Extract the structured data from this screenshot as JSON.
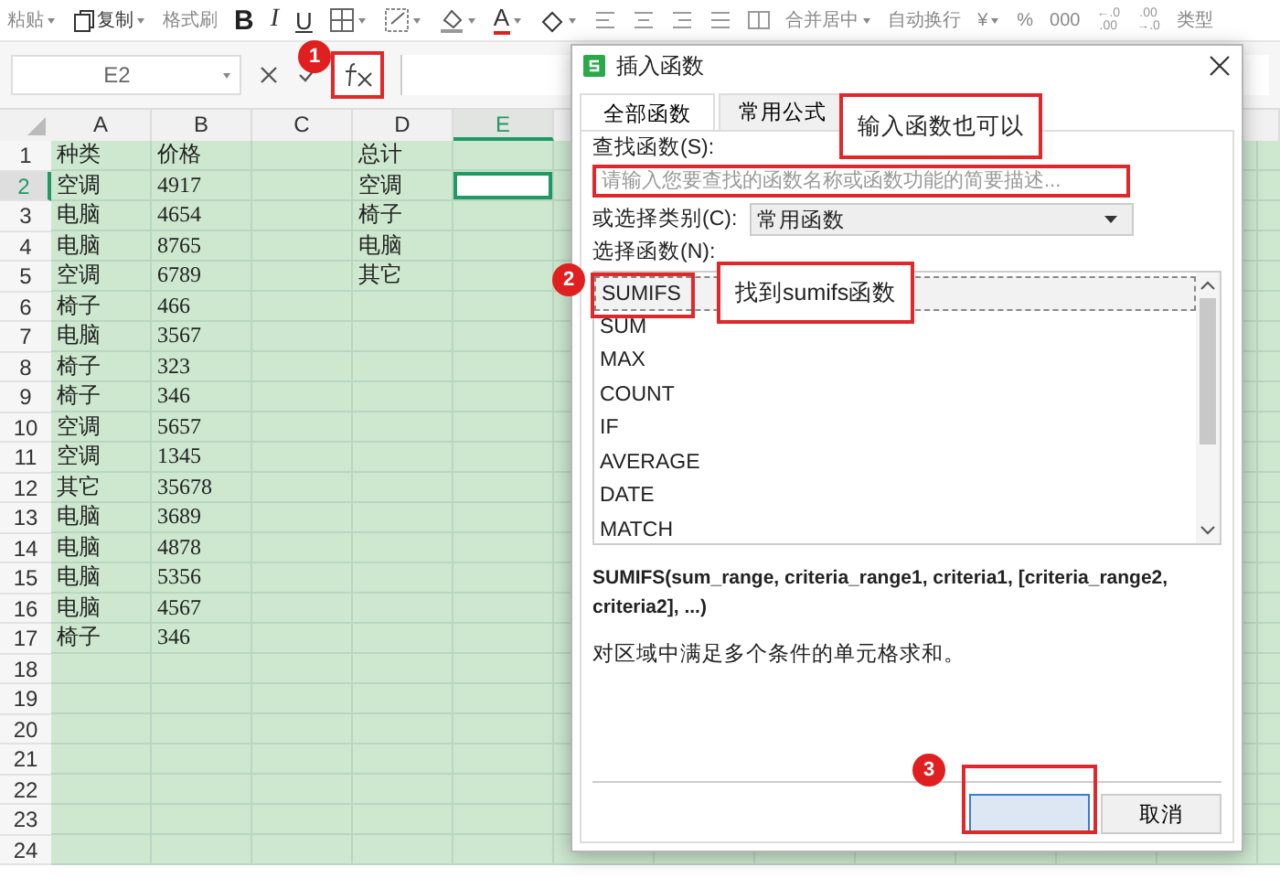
{
  "toolbar": {
    "items": [
      {
        "kind": "text",
        "label": "粘贴",
        "caret": true
      },
      {
        "kind": "copy",
        "label": "复制",
        "caret": true
      },
      {
        "kind": "text",
        "label": "格式刷",
        "caret": false
      },
      {
        "kind": "bold",
        "label": "B",
        "caret": false
      },
      {
        "kind": "italic",
        "label": "I",
        "caret": false
      },
      {
        "kind": "underline",
        "label": "U",
        "caret": false
      },
      {
        "kind": "border",
        "caret": true
      },
      {
        "kind": "cellstyle",
        "caret": true
      },
      {
        "kind": "fill",
        "caret": true
      },
      {
        "kind": "fontcolor",
        "label": "A",
        "caret": true
      },
      {
        "kind": "eraser",
        "caret": true
      },
      {
        "kind": "align_left",
        "caret": false
      },
      {
        "kind": "align_center",
        "caret": false
      },
      {
        "kind": "align_right",
        "caret": false
      },
      {
        "kind": "justify",
        "caret": false
      },
      {
        "kind": "split_cell",
        "caret": false
      },
      {
        "kind": "text",
        "label": "合并居中",
        "caret": true
      },
      {
        "kind": "text",
        "label": "自动换行",
        "caret": false
      },
      {
        "kind": "text",
        "label": "¥",
        "caret": true
      },
      {
        "kind": "text",
        "label": "%",
        "caret": false
      },
      {
        "kind": "text",
        "label": "000",
        "caret": false
      },
      {
        "kind": "stack",
        "top": "←.0",
        "bottom": ".00",
        "caret": false
      },
      {
        "kind": "stack",
        "top": ".00",
        "bottom": "→.0",
        "caret": false
      },
      {
        "kind": "text",
        "label": "类型",
        "caret": false
      }
    ]
  },
  "formula_bar": {
    "cell_ref": "E2"
  },
  "sheet": {
    "columns": [
      {
        "label": "A",
        "selected": false
      },
      {
        "label": "B",
        "selected": false
      },
      {
        "label": "C",
        "selected": false
      },
      {
        "label": "D",
        "selected": false
      },
      {
        "label": "E",
        "selected": true
      }
    ],
    "rows": [
      {
        "number": "1",
        "selected": false,
        "a": "种类",
        "b": "价格",
        "d": "总计"
      },
      {
        "number": "2",
        "selected": true,
        "a": "空调",
        "b": "4917",
        "d": "空调"
      },
      {
        "number": "3",
        "selected": false,
        "a": "电脑",
        "b": "4654",
        "d": "椅子"
      },
      {
        "number": "4",
        "selected": false,
        "a": "电脑",
        "b": "8765",
        "d": "电脑"
      },
      {
        "number": "5",
        "selected": false,
        "a": "空调",
        "b": "6789",
        "d": "其它"
      },
      {
        "number": "6",
        "selected": false,
        "a": "椅子",
        "b": "466"
      },
      {
        "number": "7",
        "selected": false,
        "a": "电脑",
        "b": "3567"
      },
      {
        "number": "8",
        "selected": false,
        "a": "椅子",
        "b": "323"
      },
      {
        "number": "9",
        "selected": false,
        "a": "椅子",
        "b": "346"
      },
      {
        "number": "10",
        "selected": false,
        "a": "空调",
        "b": "5657"
      },
      {
        "number": "11",
        "selected": false,
        "a": "空调",
        "b": "1345"
      },
      {
        "number": "12",
        "selected": false,
        "a": "其它",
        "b": "35678"
      },
      {
        "number": "13",
        "selected": false,
        "a": "电脑",
        "b": "3689"
      },
      {
        "number": "14",
        "selected": false,
        "a": "电脑",
        "b": "4878"
      },
      {
        "number": "15",
        "selected": false,
        "a": "电脑",
        "b": "5356"
      },
      {
        "number": "16",
        "selected": false,
        "a": "电脑",
        "b": "4567"
      },
      {
        "number": "17",
        "selected": false,
        "a": "椅子",
        "b": "346"
      },
      {
        "number": "18",
        "selected": false
      },
      {
        "number": "19",
        "selected": false
      },
      {
        "number": "20",
        "selected": false
      },
      {
        "number": "21",
        "selected": false
      },
      {
        "number": "22",
        "selected": false
      },
      {
        "number": "23",
        "selected": false
      },
      {
        "number": "24",
        "selected": false
      }
    ]
  },
  "dialog": {
    "title": "插入函数",
    "tabs": [
      {
        "label": "全部函数",
        "selected": true
      },
      {
        "label": "常用公式",
        "selected": false
      }
    ],
    "search_label": "查找函数(S):",
    "search_placeholder": "请输入您要查找的函数名称或函数功能的简要描述...",
    "category_label": "或选择类别(C):",
    "category_value": "常用函数",
    "list_label": "选择函数(N):",
    "functions": [
      {
        "name": "SUMIFS",
        "selected": true
      },
      {
        "name": "SUM",
        "selected": false
      },
      {
        "name": "MAX",
        "selected": false
      },
      {
        "name": "COUNT",
        "selected": false
      },
      {
        "name": "IF",
        "selected": false
      },
      {
        "name": "AVERAGE",
        "selected": false
      },
      {
        "name": "DATE",
        "selected": false
      },
      {
        "name": "MATCH",
        "selected": false
      }
    ],
    "signature": "SUMIFS(sum_range, criteria_range1, criteria1, [criteria_range2, criteria2], ...)",
    "description": "对区域中满足多个条件的单元格求和。",
    "buttons": [
      {
        "kind": "primary"
      },
      {
        "kind": "secondary",
        "label": "取消"
      }
    ]
  },
  "annotations": {
    "markers": [
      "1",
      "2",
      "3"
    ],
    "notes": [
      "输入函数也可以",
      "找到sumifs函数"
    ]
  }
}
